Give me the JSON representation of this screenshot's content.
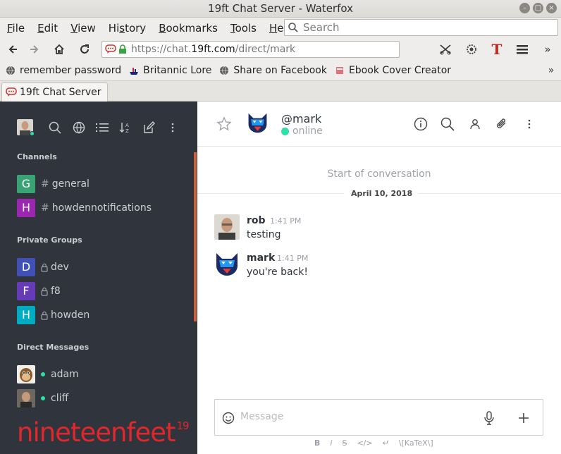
{
  "window": {
    "title": "19ft Chat Server - Waterfox",
    "controls": [
      "minimize",
      "maximize",
      "close"
    ]
  },
  "menubar": {
    "items": [
      {
        "label": "File",
        "accel": "F",
        "rest": "ile"
      },
      {
        "label": "Edit",
        "accel": "E",
        "rest": "dit"
      },
      {
        "label": "View",
        "accel": "V",
        "rest": "iew"
      },
      {
        "label": "History",
        "accel": "",
        "pre": "Hi",
        "accel2": "s",
        "rest": "tory"
      },
      {
        "label": "Bookmarks",
        "accel": "B",
        "rest": "ookmarks"
      },
      {
        "label": "Tools",
        "accel": "T",
        "rest": "ools"
      },
      {
        "label": "Help",
        "accel": "H",
        "rest": "elp"
      }
    ],
    "search_placeholder": "Search"
  },
  "navbar": {
    "url_scheme": "https://chat.",
    "url_host": "19ft.com",
    "url_path": "/direct/mark"
  },
  "bookmarks": [
    {
      "label": "remember password",
      "icon": "globe-icon"
    },
    {
      "label": "Britannic Lore",
      "icon": "ship-icon"
    },
    {
      "label": "Share on Facebook",
      "icon": "globe-icon"
    },
    {
      "label": "Ebook Cover Creator",
      "icon": "book-icon"
    }
  ],
  "tab": {
    "title": "19ft Chat Server"
  },
  "sidebar": {
    "sections": {
      "channels": "Channels",
      "private": "Private Groups",
      "direct": "Direct Messages"
    },
    "channels": [
      {
        "letter": "G",
        "name": "general",
        "color": "#3aa376"
      },
      {
        "letter": "H",
        "name": "howdennotifications",
        "color": "#9b27b0"
      }
    ],
    "private_groups": [
      {
        "letter": "D",
        "name": "dev",
        "color": "#3f51b5"
      },
      {
        "letter": "F",
        "name": "f8",
        "color": "#673ab7"
      },
      {
        "letter": "H",
        "name": "howden",
        "color": "#00acc1"
      }
    ],
    "direct_messages": [
      {
        "name": "adam",
        "status": "online"
      },
      {
        "name": "cliff",
        "status": "online"
      }
    ],
    "brand": {
      "text": "nineteenfeet",
      "sup": "19",
      "color": "#e0282c"
    }
  },
  "room": {
    "name": "@mark",
    "status": "online",
    "conversation_start": "Start of conversation",
    "date": "April 10, 2018",
    "messages": [
      {
        "user": "rob",
        "time": "1:41 PM",
        "text": "testing"
      },
      {
        "user": "mark",
        "time": "1:41 PM",
        "text": "you're back!"
      }
    ],
    "composer_placeholder": "Message",
    "format_buttons": [
      "B",
      "i",
      "S",
      "</>",
      "↵",
      "\\[KaTeX\\]"
    ]
  },
  "colors": {
    "sidebar_bg": "#2f343d",
    "online": "#2de0a5",
    "accent_scroll": "#d0623a"
  }
}
